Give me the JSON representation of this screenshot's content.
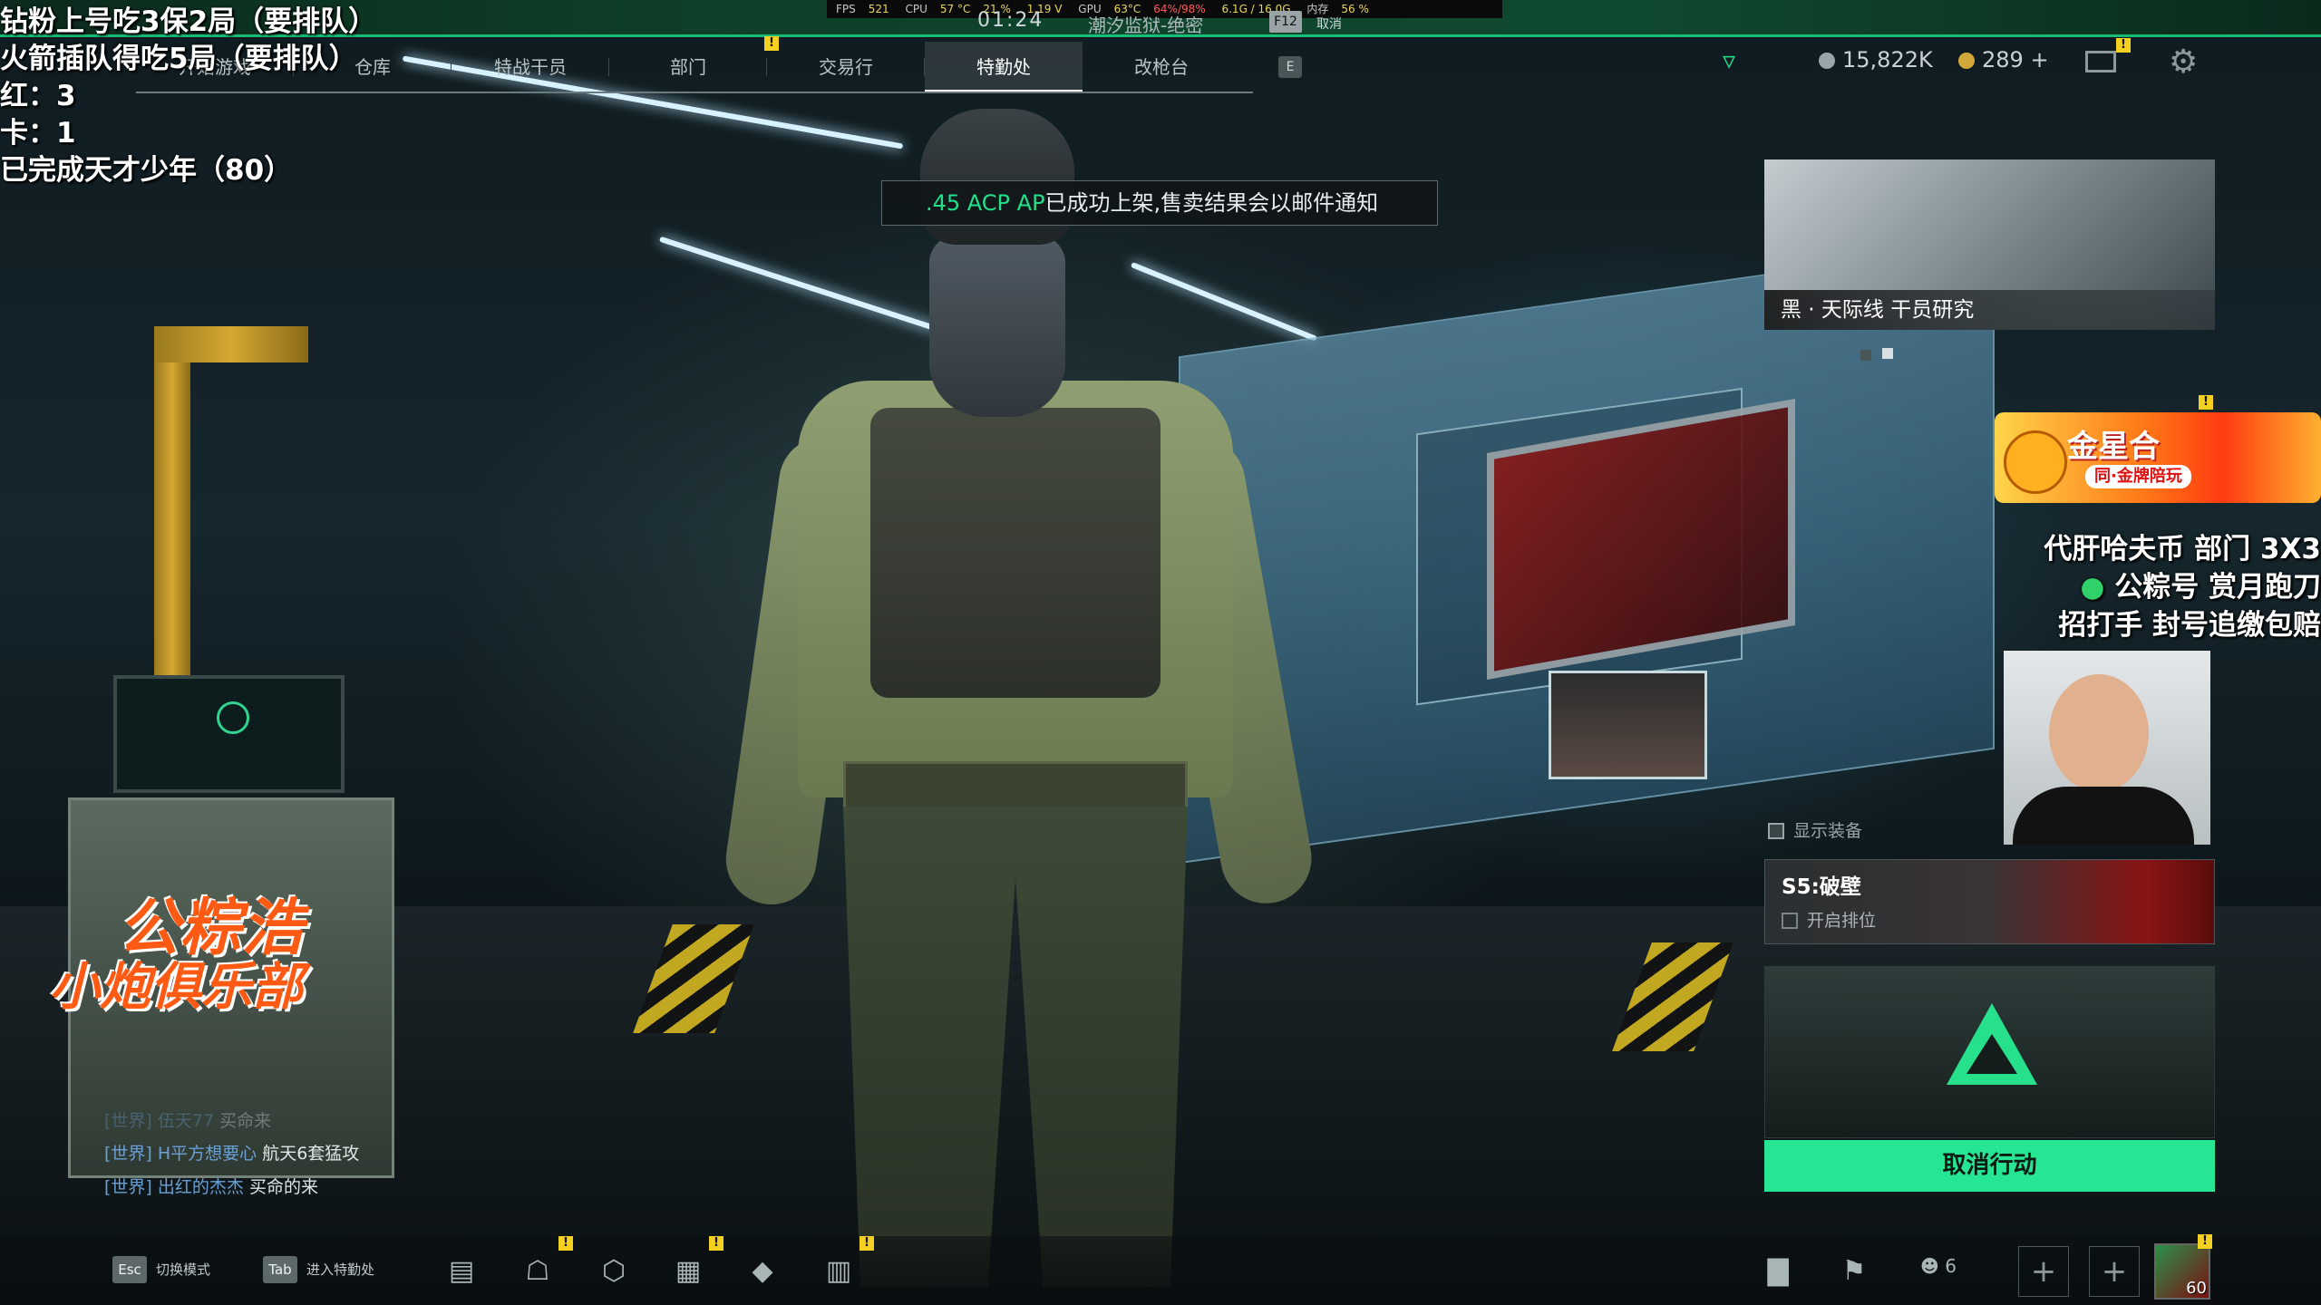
{
  "stream_overlay": {
    "lines": [
      "钻粉上号吃3保2局（要排队）",
      "火箭插队得吃5局（要排队）",
      "红：3",
      "卡：1",
      "已完成天才少年（80）"
    ]
  },
  "perf_bar": {
    "fps_label": "FPS",
    "fps": "521",
    "cpu_label": "CPU",
    "cpu_temp": "57 °C",
    "cpu_usage": "21 %",
    "voltage": "1.19 V",
    "gpu_label": "GPU",
    "gpu_temp": "63°C",
    "gpu_usage": "64%/98%",
    "vram": "6.1G / 16.0G",
    "mem_label": "内存",
    "mem": "56 %"
  },
  "header": {
    "time": "01:24",
    "map": "潮汐监狱-绝密",
    "key": "F12",
    "key_label": "取消"
  },
  "nav": {
    "tabs": [
      {
        "label": "开始游戏",
        "active": false
      },
      {
        "label": "仓库",
        "active": false
      },
      {
        "label": "特战干员",
        "active": false
      },
      {
        "label": "部门",
        "active": false
      },
      {
        "label": "交易行",
        "active": false
      },
      {
        "label": "特勤处",
        "active": true
      },
      {
        "label": "改枪台",
        "active": false
      }
    ],
    "e_key": "E"
  },
  "resources": {
    "currency": "15,822K",
    "coins": "289 +"
  },
  "notification": {
    "highlight": ".45 ACP AP",
    "text": "已成功上架,售卖结果会以邮件通知"
  },
  "banner": {
    "label": "黑 · 天际线 干员研究"
  },
  "promo": {
    "title": "金星合",
    "subtitle": "同·金牌陪玩"
  },
  "ads": {
    "line1": "代肝哈夫币 部门 3X3",
    "line2_pre": "公粽号",
    "line2_post": "赏月跑刀",
    "line3": "招打手 封号追缴包赔"
  },
  "show_equipment": "显示装备",
  "season": {
    "title": "S5:破壁",
    "ranked": "开启排位"
  },
  "action": {
    "cancel": "取消行动"
  },
  "brand": {
    "line1": "公粽浩",
    "line2": "小炮俱乐部"
  },
  "chat": [
    {
      "channel": "[世界]",
      "name": "伍天77",
      "msg": "买命来",
      "faded": true
    },
    {
      "channel": "[世界]",
      "name": "H平方想要心",
      "msg": "航天6套猛攻",
      "faded": false
    },
    {
      "channel": "[世界]",
      "name": "出红的杰杰",
      "msg": "买命的来",
      "faded": false
    }
  ],
  "bottom": {
    "esc_key": "Esc",
    "esc_label": "切换模式",
    "tab_key": "Tab",
    "tab_label": "进入特勤处",
    "friends_count": "6",
    "level": "60"
  },
  "colors": {
    "accent": "#26e694",
    "warning": "#f4d020",
    "brand": "#ff5a14"
  }
}
